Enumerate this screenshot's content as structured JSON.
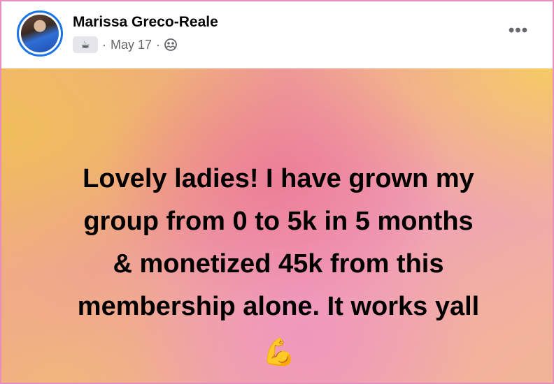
{
  "author": {
    "name": "Marissa Greco-Reale"
  },
  "meta": {
    "badge_icon": "coffee-cup-icon",
    "badge_glyph": "☕",
    "separator": "·",
    "date": "May 17",
    "audience_icon": "members-icon"
  },
  "actions": {
    "more_label": "•••"
  },
  "post": {
    "lines": [
      "Lovely ladies! I have grown my",
      "group from 0 to 5k in 5 months",
      "& monetized 45k from this",
      "membership alone. It works yall"
    ],
    "emoji": "💪",
    "background_colors": [
      "#f1b86e",
      "#ee9c9a",
      "#ef9fb7",
      "#f6cd5f"
    ]
  },
  "colors": {
    "frame_border": "#e88fc0",
    "avatar_ring": "#1b74e4",
    "meta_text": "#65676b",
    "name_text": "#050505"
  }
}
